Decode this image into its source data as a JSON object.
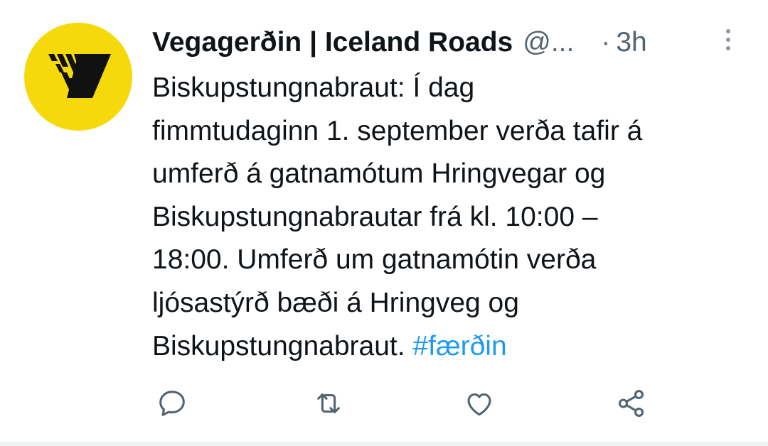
{
  "tweet": {
    "author": {
      "display_name": "Vegagerðin | Iceland Roads",
      "handle": "@...",
      "avatar_icon": "vegagerdin-logo-icon",
      "avatar_color": "#f5d90a"
    },
    "separator": "·",
    "timestamp": "3h",
    "more_icon": "more-vertical-icon",
    "text_lines": [
      "Biskupstungnabraut: Í dag",
      "fimmtudaginn 1. september verða tafir á",
      "umferð á gatnamótum Hringvegar og",
      "Biskupstungnabrautar frá kl. 10:00 –",
      "18:00. Umferð um gatnamótin verða",
      "ljósastýrð bæði á Hringveg og",
      "Biskupstungnabraut."
    ],
    "hashtag": "#færðin",
    "hashtag_color": "#1d9bf0",
    "actions": [
      {
        "name": "reply-icon"
      },
      {
        "name": "retweet-icon"
      },
      {
        "name": "like-icon"
      },
      {
        "name": "share-icon"
      }
    ],
    "secondary_text_color": "#536471"
  }
}
